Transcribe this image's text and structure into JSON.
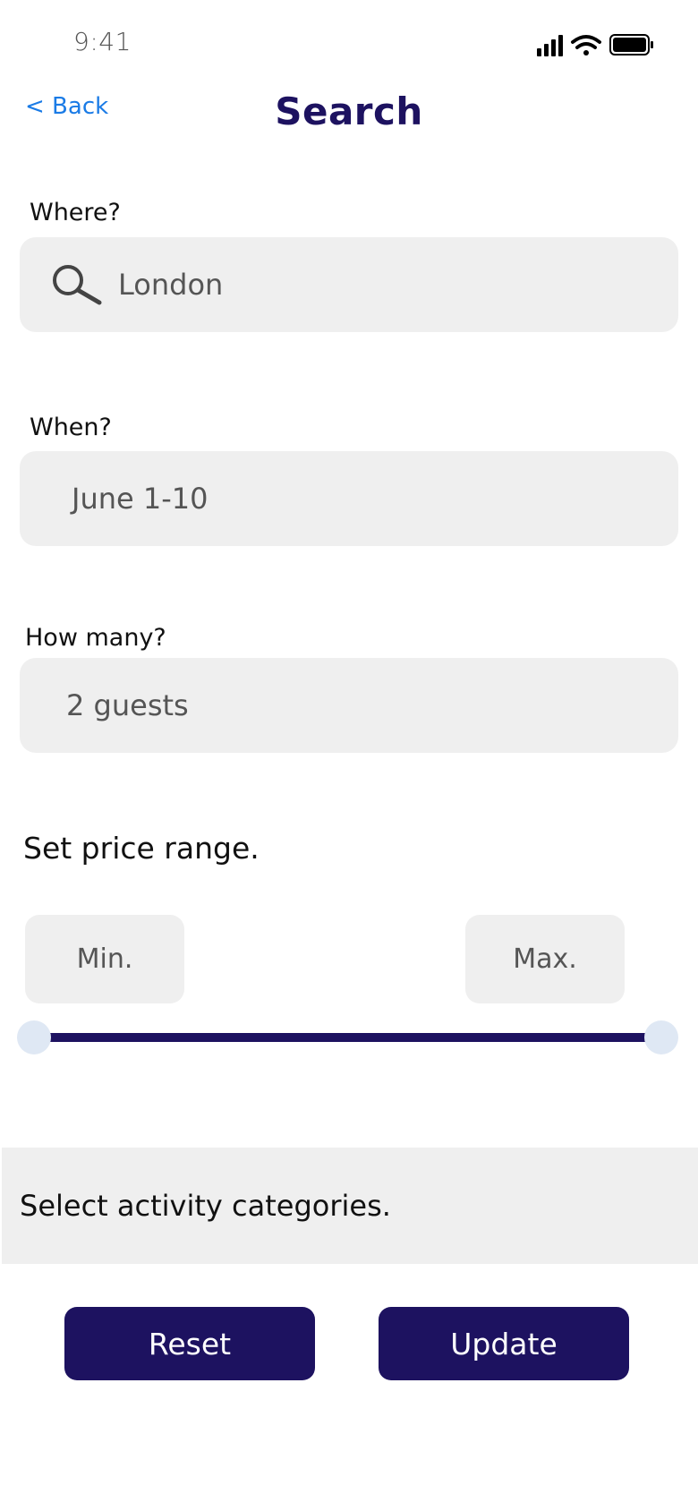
{
  "status_bar": {
    "time": "9:41",
    "signal_icon": "cellular-signal-icon",
    "wifi_icon": "wifi-icon",
    "battery_icon": "battery-icon"
  },
  "nav": {
    "back_label": "< Back",
    "title": "Search"
  },
  "where": {
    "label": "Where?",
    "value": "London",
    "icon": "search-icon"
  },
  "when": {
    "label": "When?",
    "value": "June 1-10"
  },
  "guests": {
    "label": "How many?",
    "value": "2 guests"
  },
  "price": {
    "title": "Set price range.",
    "min_label": "Min.",
    "max_label": "Max.",
    "slider_min_fraction": 0,
    "slider_max_fraction": 1
  },
  "categories": {
    "label": "Select activity categories."
  },
  "actions": {
    "reset_label": "Reset",
    "update_label": "Update"
  },
  "colors": {
    "accent": "#1d1260",
    "link": "#1a7be6",
    "field_bg": "#efefef",
    "knob": "#dfe8f4"
  }
}
